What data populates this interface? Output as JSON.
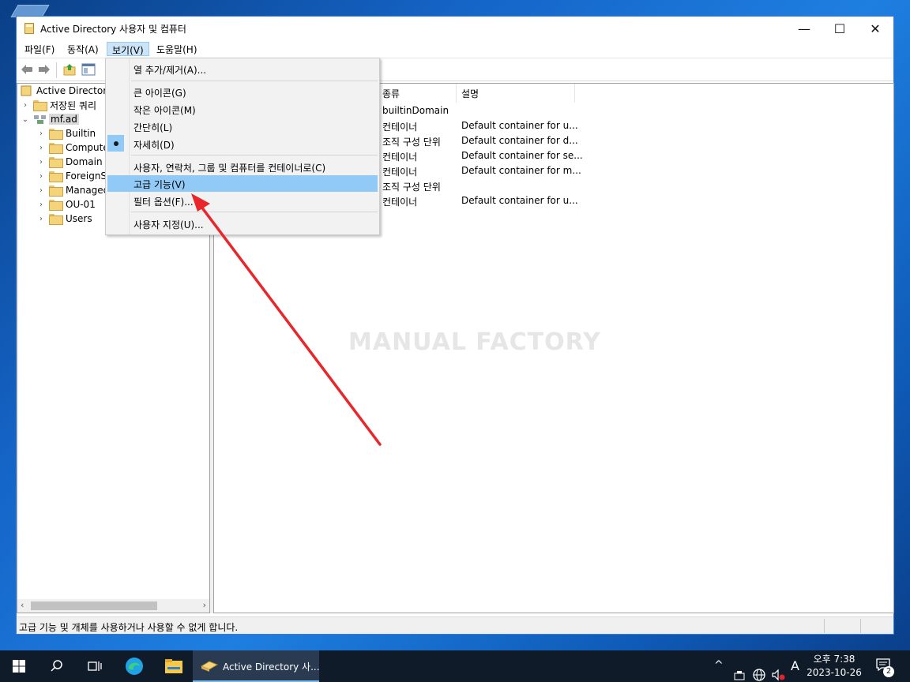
{
  "window": {
    "title": "Active Directory 사용자 및 컴퓨터",
    "minimize": "—",
    "maximize": "☐",
    "close": "✕"
  },
  "menubar": {
    "file": "파일(F)",
    "action": "동작(A)",
    "view": "보기(V)",
    "help": "도움말(H)"
  },
  "tree": {
    "root": "Active Directory",
    "saved_queries": "저장된 쿼리",
    "domain": "mf.ad",
    "children": [
      "Builtin",
      "Compute",
      "Domain C",
      "ForeignS",
      "Managed",
      "OU-01",
      "Users"
    ]
  },
  "list": {
    "columns": [
      "종류",
      "설명"
    ],
    "rows": [
      {
        "type": "builtinDomain",
        "desc": ""
      },
      {
        "type": "컨테이너",
        "desc": "Default container for u..."
      },
      {
        "type": "조직 구성 단위",
        "desc": "Default container for d..."
      },
      {
        "type": "컨테이너",
        "desc": "Default container for se..."
      },
      {
        "type": "컨테이너",
        "desc": "Default container for m..."
      },
      {
        "type": "조직 구성 단위",
        "desc": ""
      },
      {
        "type": "컨테이너",
        "desc": "Default container for u..."
      }
    ]
  },
  "watermark": "MANUAL FACTORY",
  "view_menu": {
    "add_remove_columns": "열 추가/제거(A)...",
    "large_icons": "큰 아이콘(G)",
    "small_icons": "작은 아이콘(M)",
    "list": "간단히(L)",
    "detail": "자세히(D)",
    "users_as_containers": "사용자, 연락처, 그룹 및 컴퓨터를 컨테이너로(C)",
    "advanced_features": "고급 기능(V)",
    "filter_options": "필터 옵션(F)...",
    "customize": "사용자 지정(U)...",
    "selected_view": "자세히(D)",
    "highlighted": "고급 기능(V)"
  },
  "statusbar": {
    "text": "고급 기능 및 개체를 사용하거나 사용할 수 없게 합니다."
  },
  "taskbar": {
    "app_label": "Active Directory 사...",
    "clock_period": "오후 7:38",
    "clock_date": "2023-10-26",
    "ime": "A",
    "notification_count": "2"
  },
  "colors": {
    "menu_highlight": "#91c9f7",
    "annotation_arrow": "#e8262b",
    "taskbar": "#101b2a"
  }
}
